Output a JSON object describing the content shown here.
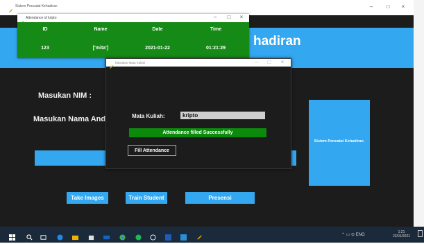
{
  "main_window": {
    "title": "Sistem Pencatat Kehadiran",
    "header_text": "hadiran",
    "nim_label": "Masukan NIM :",
    "nama_label": "Masukan Nama Anda",
    "buttons": {
      "take_images": "Take Images",
      "train_student": "Train Student",
      "presensi": "Presensi"
    },
    "side_panel_text": "Sistem Pencatat Kehadiran."
  },
  "attendance_window": {
    "title": "Attendance of kripto",
    "columns": [
      "ID",
      "Name",
      "Date",
      "Time"
    ],
    "rows": [
      [
        "123",
        "['mita']",
        "2021-01-22",
        "01:21:29"
      ]
    ]
  },
  "mata_kuliah_window": {
    "title": "Masukan Mata Kuliah",
    "label": "Mata Kuliah:",
    "input_value": "kripto",
    "status": "Attendance filled Successfully",
    "fill_button": "Fill Attendance"
  },
  "window_controls": {
    "minimize": "–",
    "maximize": "□",
    "close": "×"
  },
  "taskbar": {
    "tray_text": "⌃ ▭ ⊙ ENG",
    "clock_time": "1:21",
    "clock_date": "22/01/2021"
  },
  "colors": {
    "accent_blue": "#33a7f0",
    "success_green": "#0c8a0c",
    "grid_green": "#168a16",
    "background": "#1c1c1c"
  }
}
